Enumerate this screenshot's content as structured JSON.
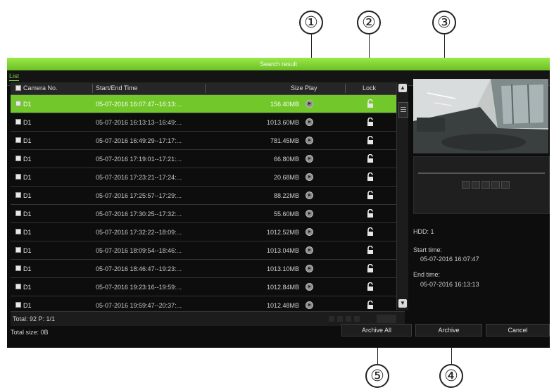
{
  "callouts": [
    "①",
    "②",
    "③",
    "④",
    "⑤"
  ],
  "window": {
    "title": "Search result",
    "tab": "List",
    "columns": [
      "Camera No.",
      "Start/End Time",
      "Size",
      "Play",
      "Lock"
    ],
    "selected_row_index": 0,
    "rows": [
      {
        "camera": "D1",
        "time": "05-07-2016 16:07:47--16:13:...",
        "size": "156.40MB"
      },
      {
        "camera": "D1",
        "time": "05-07-2016 16:13:13--16:49:...",
        "size": "1013.60MB"
      },
      {
        "camera": "D1",
        "time": "05-07-2016 16:49:29--17:17:...",
        "size": "781.45MB"
      },
      {
        "camera": "D1",
        "time": "05-07-2016 17:19:01--17:21:...",
        "size": "66.80MB"
      },
      {
        "camera": "D1",
        "time": "05-07-2016 17:23:21--17:24:...",
        "size": "20.68MB"
      },
      {
        "camera": "D1",
        "time": "05-07-2016 17:25:57--17:29:...",
        "size": "88.22MB"
      },
      {
        "camera": "D1",
        "time": "05-07-2016 17:30:25--17:32:...",
        "size": "55.60MB"
      },
      {
        "camera": "D1",
        "time": "05-07-2016 17:32:22--18:09:...",
        "size": "1012.52MB"
      },
      {
        "camera": "D1",
        "time": "05-07-2016 18:09:54--18:46:...",
        "size": "1013.04MB"
      },
      {
        "camera": "D1",
        "time": "05-07-2016 18:46:47--19:23:...",
        "size": "1013.10MB"
      },
      {
        "camera": "D1",
        "time": "05-07-2016 19:23:16--19:59:...",
        "size": "1012.84MB"
      },
      {
        "camera": "D1",
        "time": "05-07-2016 19:59:47--20:37:...",
        "size": "1012.48MB"
      }
    ],
    "total": "Total: 92  P: 1/1",
    "total_size": "Total size: 0B",
    "info": {
      "hdd": "HDD: 1",
      "start_label": "Start time:",
      "start_value": "05-07-2016 16:07:47",
      "end_label": "End time:",
      "end_value": "05-07-2016 16:13:13"
    },
    "buttons": {
      "archive_all": "Archive All",
      "archive": "Archive",
      "cancel": "Cancel"
    }
  },
  "colors": {
    "accent": "#72c72a",
    "background": "#0d0d0d"
  },
  "icons": [
    "play-icon",
    "unlock-icon",
    "scroll-up-icon",
    "scroll-down-icon"
  ]
}
